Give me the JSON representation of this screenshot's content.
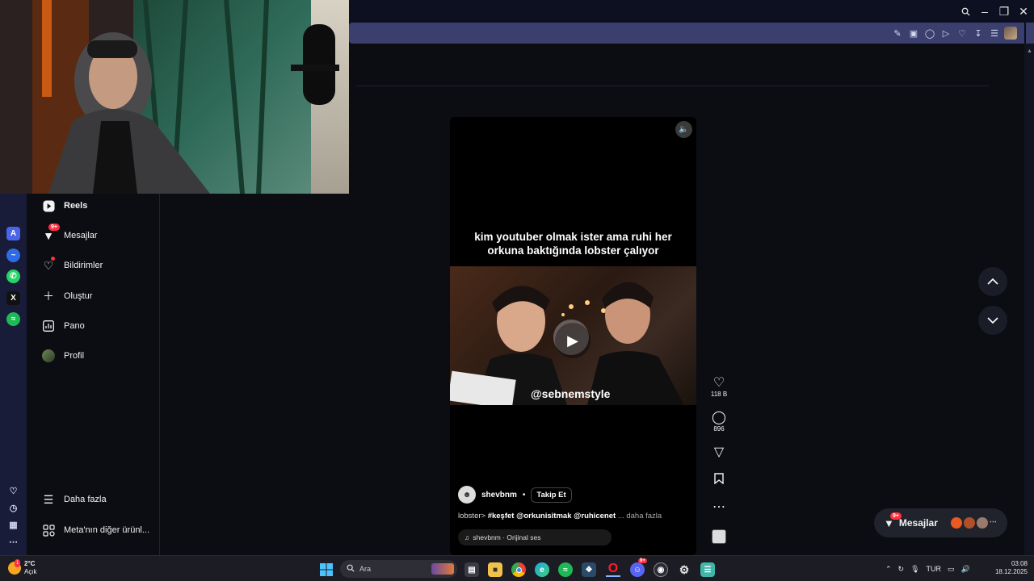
{
  "browser": {
    "toolbar_icons": [
      "edit-icon",
      "camera-icon",
      "shield-icon",
      "play-icon",
      "heart-icon",
      "download-icon",
      "menu-icon",
      "profile-avatar"
    ]
  },
  "sidebar": {
    "items": [
      {
        "label": "Reels",
        "icon": "reels-icon",
        "active": true
      },
      {
        "label": "Mesajlar",
        "icon": "messenger-icon",
        "badge": "9+"
      },
      {
        "label": "Bildirimler",
        "icon": "heart-icon",
        "dot": true
      },
      {
        "label": "Oluştur",
        "icon": "plus-icon"
      },
      {
        "label": "Pano",
        "icon": "dashboard-icon"
      },
      {
        "label": "Profil",
        "icon": "avatar"
      },
      {
        "label": "Daha fazla",
        "icon": "menu-icon"
      },
      {
        "label": "Meta'nın diğer ürünl...",
        "icon": "apps-icon"
      }
    ]
  },
  "reel": {
    "caption_line1": "kim youtuber olmak ister ama ruhi her",
    "caption_line2": "orkuna baktığında lobster çalıyor",
    "watermark": "@sebnemstyle",
    "author": "shevbnm",
    "separator": "•",
    "follow_label": "Takip Et",
    "desc_prefix": "lobster>",
    "desc_tags": "#keşfet @orkunisitmak @ruhicenet",
    "desc_more": "... daha fazla",
    "audio": "shevbnm · Orijinal ses"
  },
  "actions": {
    "likes": "118 B",
    "comments": "896"
  },
  "messages_pill": {
    "label": "Mesajlar",
    "badge": "9+"
  },
  "taskbar": {
    "weather_temp": "2°C",
    "weather_desc": "Açık",
    "weather_badge": "1",
    "search_placeholder": "Ara",
    "lang": "TUR",
    "time": "03:08",
    "date": "18.12.2025"
  },
  "colors": {
    "accent": "#ff3040",
    "toolbar": "#3a3f6e",
    "rail": "#181c38"
  }
}
